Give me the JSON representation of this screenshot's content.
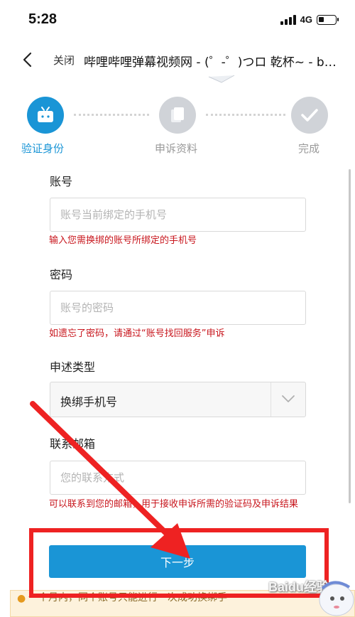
{
  "status_bar": {
    "time": "5:28",
    "network": "4G"
  },
  "nav": {
    "close_label": "关闭",
    "title": "哔哩哔哩弹幕视频网 - (゜-゜)つロ 乾杯~ - bilibili"
  },
  "steps": [
    {
      "label": "验证身份",
      "icon": "tv-icon",
      "active": true
    },
    {
      "label": "申诉资料",
      "icon": "documents-icon",
      "active": false
    },
    {
      "label": "完成",
      "icon": "check-icon",
      "active": false
    }
  ],
  "form": {
    "account": {
      "label": "账号",
      "placeholder": "账号当前绑定的手机号",
      "hint": "输入您需换绑的账号所绑定的手机号"
    },
    "password": {
      "label": "密码",
      "placeholder": "账号的密码",
      "hint": "如遗忘了密码，请通过“账号找回服务”申诉"
    },
    "type": {
      "label": "申述类型",
      "value": "换绑手机号"
    },
    "email": {
      "label": "联系邮箱",
      "placeholder": "您的联系方式",
      "hint": "可以联系到您的邮箱，用于接收申诉所需的验证码及申诉结果"
    },
    "next_label": "下一步"
  },
  "notice": {
    "text": "一个月内，同个账号只能进行一次成功换绑手"
  },
  "watermark": {
    "text": "Baidu经验"
  },
  "colors": {
    "accent": "#1a95d6",
    "hint": "#c8161d",
    "annotation": "#ee2222",
    "step_inactive": "#d0d3d8"
  }
}
